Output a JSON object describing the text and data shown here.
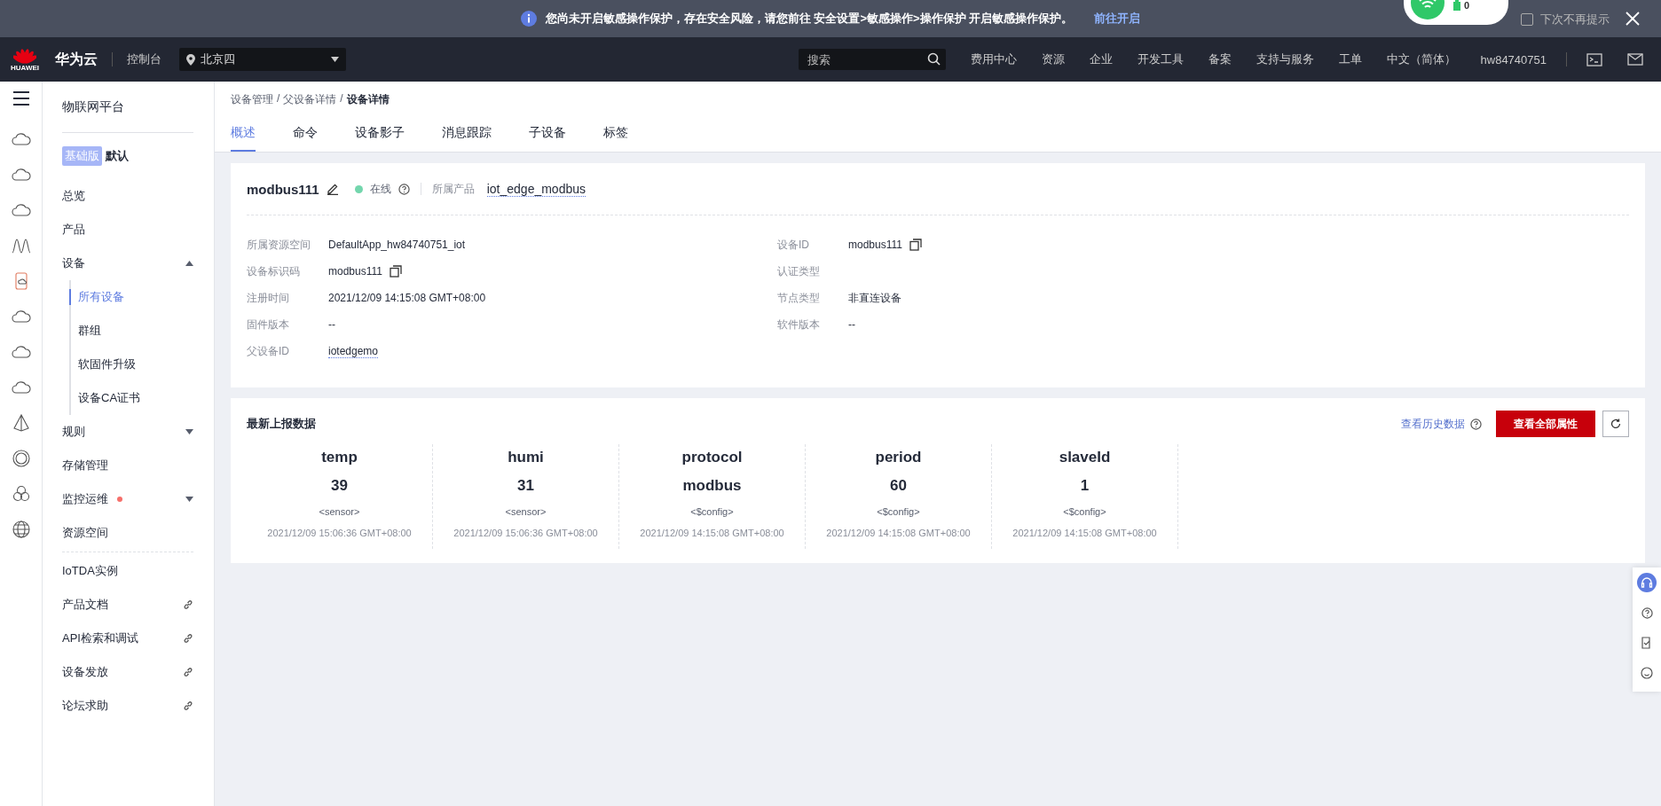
{
  "notice": {
    "message": "您尚未开启敏感操作保护，存在安全风险，请您前往 安全设置>敏感操作>操作保护 开启敏感操作保护。",
    "link": "前往开启",
    "dismiss": {
      "label": "下次不再提示",
      "checked": false
    }
  },
  "popup": {
    "battery": "0"
  },
  "navbar": {
    "logo_text": "HUAWEI",
    "brand": "华为云",
    "console": "控制台",
    "region": "北京四",
    "search": {
      "placeholder": "搜索"
    },
    "links": [
      "费用中心",
      "资源",
      "企业",
      "开发工具",
      "备案",
      "支持与服务",
      "工单",
      "中文（简体）"
    ],
    "user": "hw84740751"
  },
  "sidebar": {
    "title": "物联网平台",
    "edition_badge": "基础版",
    "edition_name": "默认",
    "items": [
      {
        "label": "总览",
        "selected": false
      },
      {
        "label": "产品",
        "selected": false
      },
      {
        "label": "设备",
        "selected": false,
        "expanded": true,
        "children": [
          {
            "label": "所有设备",
            "selected": true
          },
          {
            "label": "群组",
            "selected": false
          },
          {
            "label": "软固件升级",
            "selected": false
          },
          {
            "label": "设备CA证书",
            "selected": false
          }
        ]
      },
      {
        "label": "规则",
        "selected": false,
        "expanded": false
      },
      {
        "label": "存储管理",
        "selected": false
      },
      {
        "label": "监控运维",
        "selected": false,
        "expanded": false,
        "alert": true
      },
      {
        "label": "资源空间",
        "selected": false
      }
    ],
    "extra_items": [
      {
        "label": "IoTDA实例",
        "external": false
      },
      {
        "label": "产品文档",
        "external": true
      },
      {
        "label": "API检索和调试",
        "external": true
      },
      {
        "label": "设备发放",
        "external": true
      },
      {
        "label": "论坛求助",
        "external": true
      }
    ]
  },
  "breadcrumb": [
    {
      "label": "设备管理",
      "kind": "link"
    },
    {
      "label": "/",
      "kind": "separator"
    },
    {
      "label": "父设备详情",
      "kind": "link"
    },
    {
      "label": "/",
      "kind": "separator"
    },
    {
      "label": "设备详情",
      "kind": "current"
    }
  ],
  "tabs": [
    {
      "label": "概述",
      "selected": true
    },
    {
      "label": "命令",
      "selected": false
    },
    {
      "label": "设备影子",
      "selected": false
    },
    {
      "label": "消息跟踪",
      "selected": false
    },
    {
      "label": "子设备",
      "selected": false
    },
    {
      "label": "标签",
      "selected": false
    }
  ],
  "device": {
    "name": "modbus111",
    "online": true,
    "status": "在线",
    "product_label": "所属产品",
    "product": "iot_edge_modbus",
    "fields_left": [
      {
        "label": "所属资源空间",
        "value": "DefaultApp_hw84740751_iot"
      },
      {
        "label": "设备标识码",
        "value": "modbus111",
        "copyable": true
      },
      {
        "label": "注册时间",
        "value": "2021/12/09 14:15:08 GMT+08:00"
      },
      {
        "label": "固件版本",
        "value": "--"
      },
      {
        "label": "父设备ID",
        "value": "iotedgemo",
        "link": true
      }
    ],
    "fields_right": [
      {
        "label": "设备ID",
        "value": "modbus111",
        "copyable": true
      },
      {
        "label": "认证类型"
      },
      {
        "label": "节点类型",
        "value": "非直连设备"
      },
      {
        "label": "软件版本",
        "value": "--"
      }
    ]
  },
  "latest_data": {
    "title": "最新上报数据",
    "history_link": "查看历史数据",
    "all_button": "查看全部属性",
    "properties": [
      {
        "name": "temp",
        "value": "39",
        "type": "<sensor>",
        "time": "2021/12/09 15:06:36 GMT+08:00"
      },
      {
        "name": "humi",
        "value": "31",
        "type": "<sensor>",
        "time": "2021/12/09 15:06:36 GMT+08:00"
      },
      {
        "name": "protocol",
        "value": "modbus",
        "type": "<$config>",
        "time": "2021/12/09 14:15:08 GMT+08:00"
      },
      {
        "name": "period",
        "value": "60",
        "type": "<$config>",
        "time": "2021/12/09 14:15:08 GMT+08:00"
      },
      {
        "name": "slaveId",
        "value": "1",
        "type": "<$config>",
        "time": "2021/12/09 14:15:08 GMT+08:00"
      }
    ]
  }
}
